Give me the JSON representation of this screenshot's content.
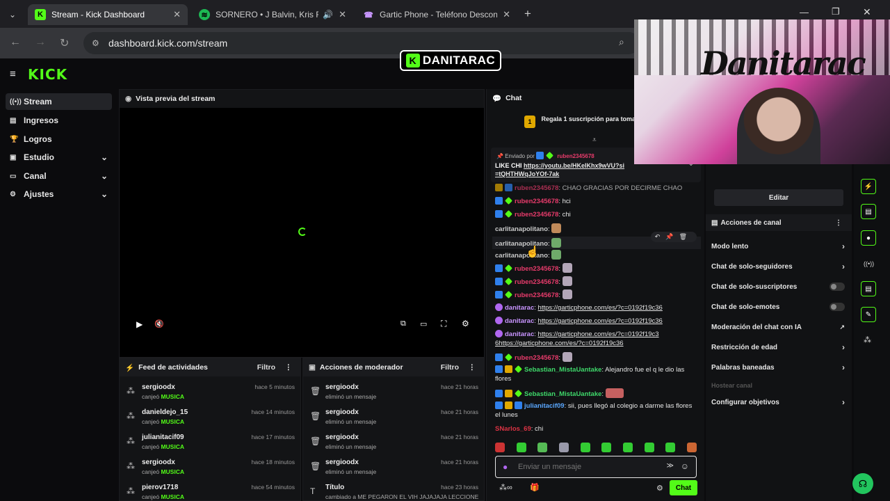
{
  "browser": {
    "tabs": [
      {
        "label": "Stream - Kick Dashboard",
        "icon": "kick-icon"
      },
      {
        "label": "SORNERO • J Balvin, Kris R.",
        "icon": "spotify-icon"
      },
      {
        "label": "Gartic Phone - Teléfono Descon",
        "icon": "gartic-icon"
      }
    ],
    "url": "dashboard.kick.com/stream"
  },
  "overlay": {
    "streamer_tag": "DANITARAC",
    "webcam_sign": "Danitarac"
  },
  "app": {
    "logo": "KICK"
  },
  "sidebar": {
    "items": [
      {
        "label": "Stream"
      },
      {
        "label": "Ingresos"
      },
      {
        "label": "Logros"
      },
      {
        "label": "Estudio"
      },
      {
        "label": "Canal"
      },
      {
        "label": "Ajustes"
      }
    ]
  },
  "preview": {
    "title": "Vista previa del stream"
  },
  "activity": {
    "title": "Feed de actividades",
    "filter": "Filtro",
    "rows": [
      {
        "user": "sergioodx",
        "action": "canjeó",
        "item": "MUSICA",
        "time": "hace 5 minutos"
      },
      {
        "user": "danieldejo_15",
        "action": "canjeó",
        "item": "MUSICA",
        "time": "hace 14 minutos"
      },
      {
        "user": "julianitacif09",
        "action": "canjeó",
        "item": "MUSICA",
        "time": "hace 17 minutos"
      },
      {
        "user": "sergioodx",
        "action": "canjeó",
        "item": "MUSICA",
        "time": "hace 18 minutos"
      },
      {
        "user": "pierov1718",
        "action": "canjeó",
        "item": "MUSICA",
        "time": "hace 54 minutos"
      }
    ]
  },
  "modactions": {
    "title": "Acciones de moderador",
    "filter": "Filtro",
    "rows": [
      {
        "user": "sergioodx",
        "action": "eliminó un mensaje",
        "time": "hace 21 horas"
      },
      {
        "user": "sergioodx",
        "action": "eliminó un mensaje",
        "time": "hace 21 horas"
      },
      {
        "user": "sergioodx",
        "action": "eliminó un mensaje",
        "time": "hace 21 horas"
      },
      {
        "user": "sergioodx",
        "action": "eliminó un mensaje",
        "time": "hace 21 horas"
      },
      {
        "user": "Título",
        "action": "cambiado a ME PEGARON EL VIH JAJAJAJA LECCIONES",
        "time": "hace 23 horas"
      }
    ]
  },
  "chat": {
    "title": "Chat",
    "gift_banner": "Regala 1 suscripción para tomar l",
    "gift_count": "1",
    "pinned": {
      "sent_by": "Enviado por",
      "user": "ruben2345678",
      "text": "LIKE CHI",
      "link": "https://youtu.be/HKeIKhx9wVU?si=tQHTHWqJoYOf-7ak"
    },
    "messages": [
      {
        "user": "ruben2345678",
        "text": ": CHAO GRACIAS POR DECIRME CHAO"
      },
      {
        "user": "ruben2345678",
        "text": ": hci"
      },
      {
        "user": "ruben2345678",
        "text": ": chi"
      },
      {
        "user": "carlitanapolitano",
        "text": ":"
      },
      {
        "user": "carlitanapolitano",
        "text": ":"
      },
      {
        "user": "carlitanapolitano",
        "text": ":"
      },
      {
        "user": "ruben2345678",
        "text": ":"
      },
      {
        "user": "ruben2345678",
        "text": ":"
      },
      {
        "user": "ruben2345678",
        "text": ":"
      },
      {
        "user": "danitarac",
        "text": ": ",
        "link": "https://garticphone.com/es/?c=0192f19c36"
      },
      {
        "user": "danitarac",
        "text": ": ",
        "link": "https://garticphone.com/es/?c=0192f19c36"
      },
      {
        "user": "danitarac",
        "text": ": ",
        "link": "https://garticphone.com/es/?c=0192f19c36https://garticphone.com/es/?c=0192f19c36"
      },
      {
        "user": "ruben2345678",
        "text": ":"
      },
      {
        "user": "Sebastian_MistaUantake",
        "text": ": Alejandro fue el q le dio las flores"
      },
      {
        "user": "Sebastian_MistaUantake",
        "text": ":"
      },
      {
        "user": "julianitacif09",
        "text": ": sii, pues llegó al colegio a darme las flores el lunes"
      },
      {
        "user": "SNarlos_69",
        "text": ": chi"
      }
    ],
    "input_placeholder": "Enviar un mensaje",
    "send_label": "Chat"
  },
  "moderation": {
    "edit_label": "Editar",
    "channel_actions_title": "Acciones de canal",
    "items": [
      {
        "label": "Modo lento",
        "type": "arrow"
      },
      {
        "label": "Chat de solo-seguidores",
        "type": "arrow"
      },
      {
        "label": "Chat de solo-suscriptores",
        "type": "toggle"
      },
      {
        "label": "Chat de solo-emotes",
        "type": "toggle"
      },
      {
        "label": "Moderación del chat con IA",
        "type": "external"
      },
      {
        "label": "Restricción de edad",
        "type": "arrow"
      },
      {
        "label": "Palabras baneadas",
        "type": "arrow"
      },
      {
        "label": "Hostear canal",
        "type": "disabled"
      },
      {
        "label": "Configurar objetivos",
        "type": "arrow"
      }
    ]
  }
}
